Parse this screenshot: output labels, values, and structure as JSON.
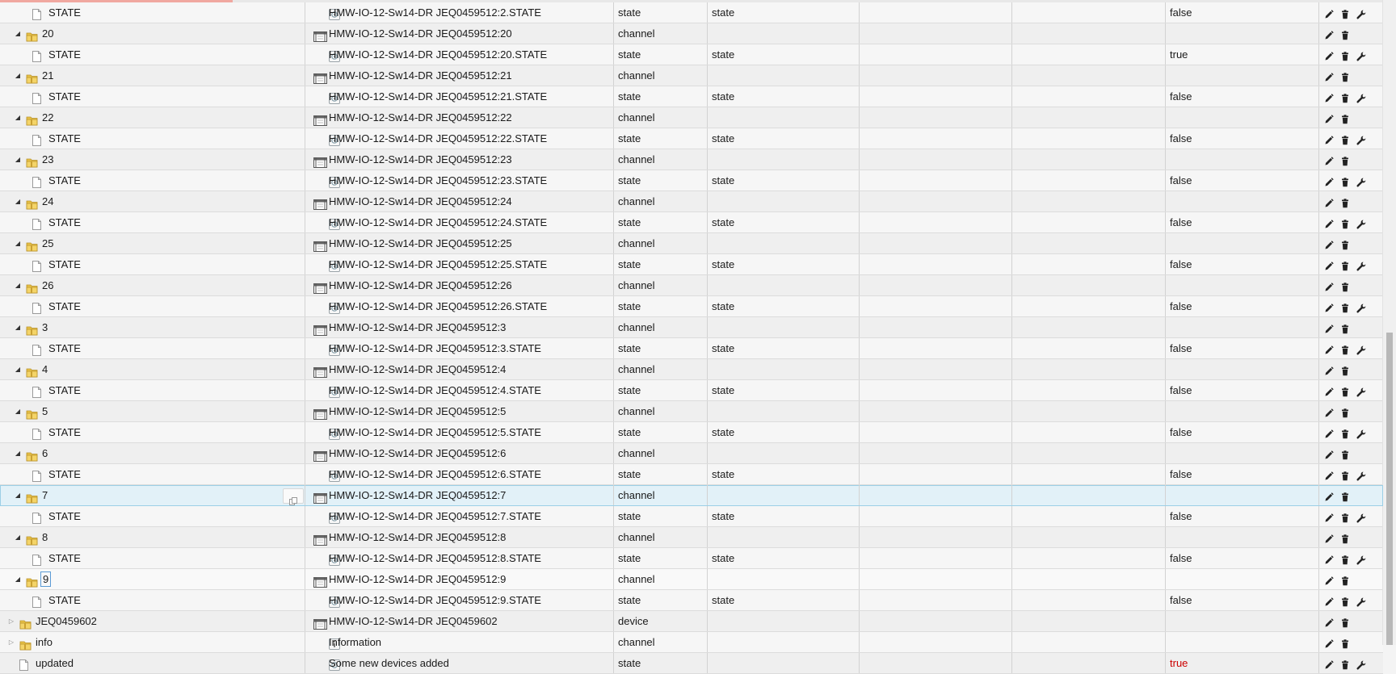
{
  "rows": [
    {
      "kind": "state",
      "name": "STATE",
      "title": "HMW-IO-12-Sw14-DR JEQ0459512:2.STATE",
      "type": "state",
      "role": "state",
      "value": "false"
    },
    {
      "kind": "channel",
      "name": "20",
      "title": "HMW-IO-12-Sw14-DR JEQ0459512:20",
      "type": "channel",
      "role": "",
      "value": ""
    },
    {
      "kind": "state",
      "name": "STATE",
      "title": "HMW-IO-12-Sw14-DR JEQ0459512:20.STATE",
      "type": "state",
      "role": "state",
      "value": "true"
    },
    {
      "kind": "channel",
      "name": "21",
      "title": "HMW-IO-12-Sw14-DR JEQ0459512:21",
      "type": "channel",
      "role": "",
      "value": ""
    },
    {
      "kind": "state",
      "name": "STATE",
      "title": "HMW-IO-12-Sw14-DR JEQ0459512:21.STATE",
      "type": "state",
      "role": "state",
      "value": "false"
    },
    {
      "kind": "channel",
      "name": "22",
      "title": "HMW-IO-12-Sw14-DR JEQ0459512:22",
      "type": "channel",
      "role": "",
      "value": ""
    },
    {
      "kind": "state",
      "name": "STATE",
      "title": "HMW-IO-12-Sw14-DR JEQ0459512:22.STATE",
      "type": "state",
      "role": "state",
      "value": "false"
    },
    {
      "kind": "channel",
      "name": "23",
      "title": "HMW-IO-12-Sw14-DR JEQ0459512:23",
      "type": "channel",
      "role": "",
      "value": ""
    },
    {
      "kind": "state",
      "name": "STATE",
      "title": "HMW-IO-12-Sw14-DR JEQ0459512:23.STATE",
      "type": "state",
      "role": "state",
      "value": "false"
    },
    {
      "kind": "channel",
      "name": "24",
      "title": "HMW-IO-12-Sw14-DR JEQ0459512:24",
      "type": "channel",
      "role": "",
      "value": ""
    },
    {
      "kind": "state",
      "name": "STATE",
      "title": "HMW-IO-12-Sw14-DR JEQ0459512:24.STATE",
      "type": "state",
      "role": "state",
      "value": "false"
    },
    {
      "kind": "channel",
      "name": "25",
      "title": "HMW-IO-12-Sw14-DR JEQ0459512:25",
      "type": "channel",
      "role": "",
      "value": ""
    },
    {
      "kind": "state",
      "name": "STATE",
      "title": "HMW-IO-12-Sw14-DR JEQ0459512:25.STATE",
      "type": "state",
      "role": "state",
      "value": "false"
    },
    {
      "kind": "channel",
      "name": "26",
      "title": "HMW-IO-12-Sw14-DR JEQ0459512:26",
      "type": "channel",
      "role": "",
      "value": ""
    },
    {
      "kind": "state",
      "name": "STATE",
      "title": "HMW-IO-12-Sw14-DR JEQ0459512:26.STATE",
      "type": "state",
      "role": "state",
      "value": "false"
    },
    {
      "kind": "channel",
      "name": "3",
      "title": "HMW-IO-12-Sw14-DR JEQ0459512:3",
      "type": "channel",
      "role": "",
      "value": ""
    },
    {
      "kind": "state",
      "name": "STATE",
      "title": "HMW-IO-12-Sw14-DR JEQ0459512:3.STATE",
      "type": "state",
      "role": "state",
      "value": "false"
    },
    {
      "kind": "channel",
      "name": "4",
      "title": "HMW-IO-12-Sw14-DR JEQ0459512:4",
      "type": "channel",
      "role": "",
      "value": ""
    },
    {
      "kind": "state",
      "name": "STATE",
      "title": "HMW-IO-12-Sw14-DR JEQ0459512:4.STATE",
      "type": "state",
      "role": "state",
      "value": "false"
    },
    {
      "kind": "channel",
      "name": "5",
      "title": "HMW-IO-12-Sw14-DR JEQ0459512:5",
      "type": "channel",
      "role": "",
      "value": ""
    },
    {
      "kind": "state",
      "name": "STATE",
      "title": "HMW-IO-12-Sw14-DR JEQ0459512:5.STATE",
      "type": "state",
      "role": "state",
      "value": "false"
    },
    {
      "kind": "channel",
      "name": "6",
      "title": "HMW-IO-12-Sw14-DR JEQ0459512:6",
      "type": "channel",
      "role": "",
      "value": ""
    },
    {
      "kind": "state",
      "name": "STATE",
      "title": "HMW-IO-12-Sw14-DR JEQ0459512:6.STATE",
      "type": "state",
      "role": "state",
      "value": "false"
    },
    {
      "kind": "channel",
      "name": "7",
      "title": "HMW-IO-12-Sw14-DR JEQ0459512:7",
      "type": "channel",
      "role": "",
      "value": "",
      "selected": true
    },
    {
      "kind": "state",
      "name": "STATE",
      "title": "HMW-IO-12-Sw14-DR JEQ0459512:7.STATE",
      "type": "state",
      "role": "state",
      "value": "false"
    },
    {
      "kind": "channel",
      "name": "8",
      "title": "HMW-IO-12-Sw14-DR JEQ0459512:8",
      "type": "channel",
      "role": "",
      "value": ""
    },
    {
      "kind": "state",
      "name": "STATE",
      "title": "HMW-IO-12-Sw14-DR JEQ0459512:8.STATE",
      "type": "state",
      "role": "state",
      "value": "false"
    },
    {
      "kind": "channel",
      "name": "9",
      "title": "HMW-IO-12-Sw14-DR JEQ0459512:9",
      "type": "channel",
      "role": "",
      "value": "",
      "focused": true
    },
    {
      "kind": "state",
      "name": "STATE",
      "title": "HMW-IO-12-Sw14-DR JEQ0459512:9.STATE",
      "type": "state",
      "role": "state",
      "value": "false"
    },
    {
      "kind": "device",
      "name": "JEQ0459602",
      "title": "HMW-IO-12-Sw14-DR JEQ0459602",
      "type": "device",
      "role": "",
      "value": ""
    },
    {
      "kind": "info",
      "name": "info",
      "title": "Information",
      "type": "channel",
      "role": "",
      "value": ""
    },
    {
      "kind": "top-state",
      "name": "updated",
      "title": "Some new devices added",
      "type": "state",
      "role": "",
      "value": "true"
    }
  ],
  "colors": {
    "value_true_top": "#cc0000",
    "selection_bg": "#e2f1f8",
    "folder": "#e8c247"
  },
  "icons": {
    "expand_open": "triangle-down-icon",
    "expand_closed": "triangle-right-icon",
    "folder": "folder-icon",
    "file": "file-icon",
    "state_type": "state-type-icon",
    "channel_type": "channel-type-icon",
    "info_type": "info-type-icon",
    "edit": "edit-icon",
    "delete": "delete-icon",
    "settings": "wrench-icon",
    "copy": "copy-icon"
  }
}
